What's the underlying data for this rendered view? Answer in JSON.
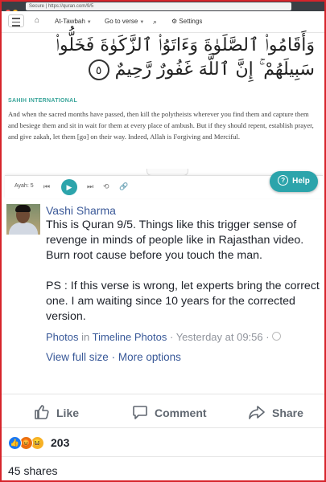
{
  "browser": {
    "url": "Secure | https://quran.com/9/5"
  },
  "quran_nav": {
    "surah": "At-Tawbah",
    "goto_label": "Go to verse",
    "settings_label": "Settings"
  },
  "verse": {
    "arabic": "وَأَقَامُوا۟ ٱلصَّلَوٰةَ وَءَاتَوُا۟ ٱلزَّكَوٰةَ فَخَلُّوا۟ سَبِيلَهُمْ ۚ إِنَّ ٱللَّهَ غَفُورٌ رَّحِيمٌ",
    "marker": "٥",
    "translator": "SAHIH INTERNATIONAL",
    "translation": "And when the sacred months have passed, then kill the polytheists wherever you find them and capture them and besiege them and sit in wait for them at every place of ambush. But if they should repent, establish prayer, and give zakah, let them [go] on their way. Indeed, Allah is Forgiving and Merciful."
  },
  "audio": {
    "ayah_label": "Ayah: 5",
    "help_label": "Help"
  },
  "post": {
    "author": "Vashi Sharma",
    "body": "This is Quran 9/5. Things like this trigger sense of revenge in minds of people like in Rajasthan video. Burn root cause before you touch the man.\n\nPS : If this verse is wrong, let experts bring the correct one. I am waiting since 10 years for the corrected version.",
    "album_prefix": "Photos",
    "album_in": "in",
    "album_name": "Timeline Photos",
    "timestamp": "· Yesterday at 09:56 ·",
    "view_full": "View full size",
    "separator": "·",
    "more_options": "More options",
    "like_label": "Like",
    "comment_label": "Comment",
    "share_label": "Share",
    "reaction_count": "203",
    "shares_label": "45 shares"
  },
  "colors": {
    "border_red": "#d6242b",
    "quran_teal": "#2ca4ab",
    "fb_blue": "#3b5998"
  }
}
